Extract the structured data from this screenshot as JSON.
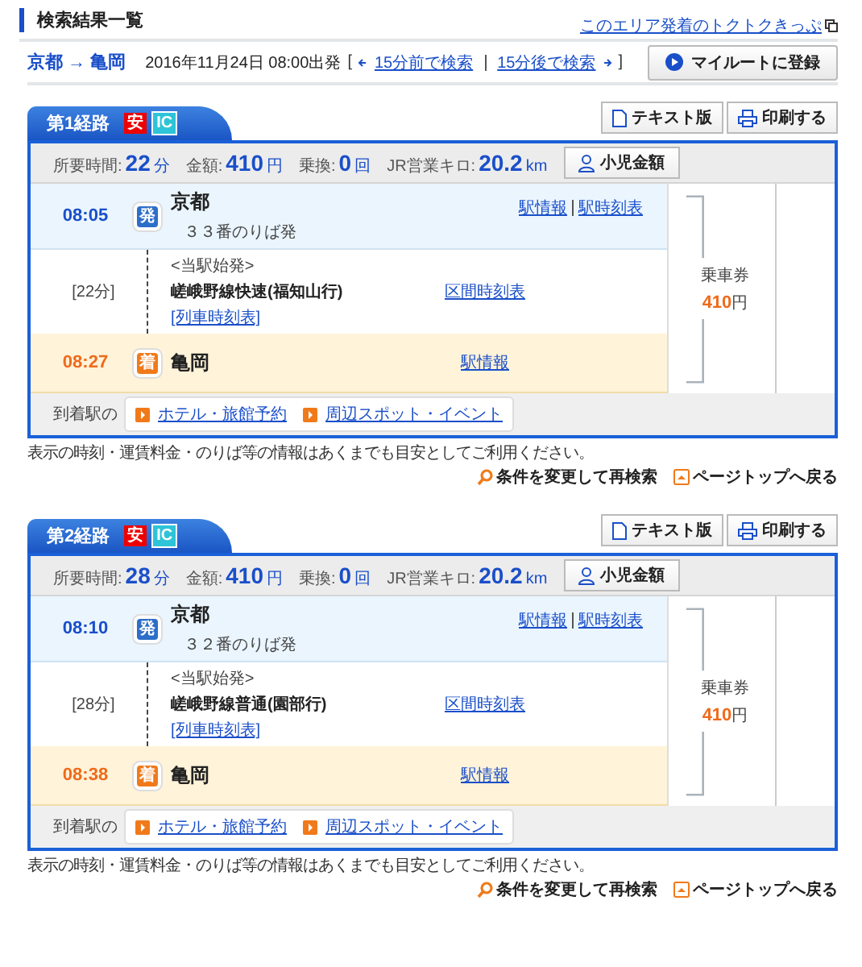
{
  "header": {
    "title": "検索結果一覧",
    "promo_link": "このエリア発着のトクトクきっぷ"
  },
  "search": {
    "route": "京都 → 亀岡",
    "datetime": "2016年11月24日 08:00出発",
    "open": "[",
    "earlier": "15分前で検索",
    "later": "15分後で検索",
    "close": "]",
    "register_button": "マイルートに登録"
  },
  "routes": [
    {
      "tab": "第**1**経路",
      "badges": [
        {
          "kind": "safe",
          "text": "安"
        },
        {
          "kind": "ic",
          "text": "IC"
        }
      ],
      "text_button": "テキスト版",
      "print_button": "印刷する",
      "summary": [
        {
          "label": "所要時間:",
          "value": "22",
          "unit": "分"
        },
        {
          "label": "金額:",
          "value": "410",
          "unit": "円"
        },
        {
          "label": "乗換:",
          "value": "0",
          "unit": "回"
        },
        {
          "label": "JR営業キロ:",
          "value": "20.2",
          "unit": "km"
        }
      ],
      "child_button": "小児金額",
      "departure": {
        "time": "08:05",
        "mark": "発",
        "station": "京都",
        "platform": "３３番のりば発",
        "links": [
          "駅情報",
          "駅時刻表"
        ]
      },
      "section": {
        "duration": "[22分]",
        "note": "<当駅始発>",
        "train": "嵯峨野線快速(福知山行)",
        "train_link": "[列車時刻表]",
        "interval_link": "区間時刻表"
      },
      "arrival": {
        "time": "08:27",
        "mark": "着",
        "station": "亀岡",
        "links": [
          "駅情報"
        ]
      },
      "fare": {
        "label": "乗車券",
        "amount": "410",
        "unit": "円"
      },
      "footer": {
        "label": "到着駅の",
        "links": [
          "ホテル・旅館予約",
          "周辺スポット・イベント"
        ]
      },
      "notice": "表示の時刻・運賃料金・のりば等の情報はあくまでも目安としてご利用ください。",
      "research_link": "条件を変更して再検索",
      "top_link": "ページトップへ戻る"
    },
    {
      "tab": "第**2**経路",
      "badges": [
        {
          "kind": "safe",
          "text": "安"
        },
        {
          "kind": "ic",
          "text": "IC"
        }
      ],
      "text_button": "テキスト版",
      "print_button": "印刷する",
      "summary": [
        {
          "label": "所要時間:",
          "value": "28",
          "unit": "分"
        },
        {
          "label": "金額:",
          "value": "410",
          "unit": "円"
        },
        {
          "label": "乗換:",
          "value": "0",
          "unit": "回"
        },
        {
          "label": "JR営業キロ:",
          "value": "20.2",
          "unit": "km"
        }
      ],
      "child_button": "小児金額",
      "departure": {
        "time": "08:10",
        "mark": "発",
        "station": "京都",
        "platform": "３２番のりば発",
        "links": [
          "駅情報",
          "駅時刻表"
        ]
      },
      "section": {
        "duration": "[28分]",
        "note": "<当駅始発>",
        "train": "嵯峨野線普通(園部行)",
        "train_link": "[列車時刻表]",
        "interval_link": "区間時刻表"
      },
      "arrival": {
        "time": "08:38",
        "mark": "着",
        "station": "亀岡",
        "links": [
          "駅情報"
        ]
      },
      "fare": {
        "label": "乗車券",
        "amount": "410",
        "unit": "円"
      },
      "footer": {
        "label": "到着駅の",
        "links": [
          "ホテル・旅館予約",
          "周辺スポット・イベント"
        ]
      },
      "notice": "表示の時刻・運賃料金・のりば等の情報はあくまでも目安としてご利用ください。",
      "research_link": "条件を変更して再検索",
      "top_link": "ページトップへ戻る"
    }
  ]
}
